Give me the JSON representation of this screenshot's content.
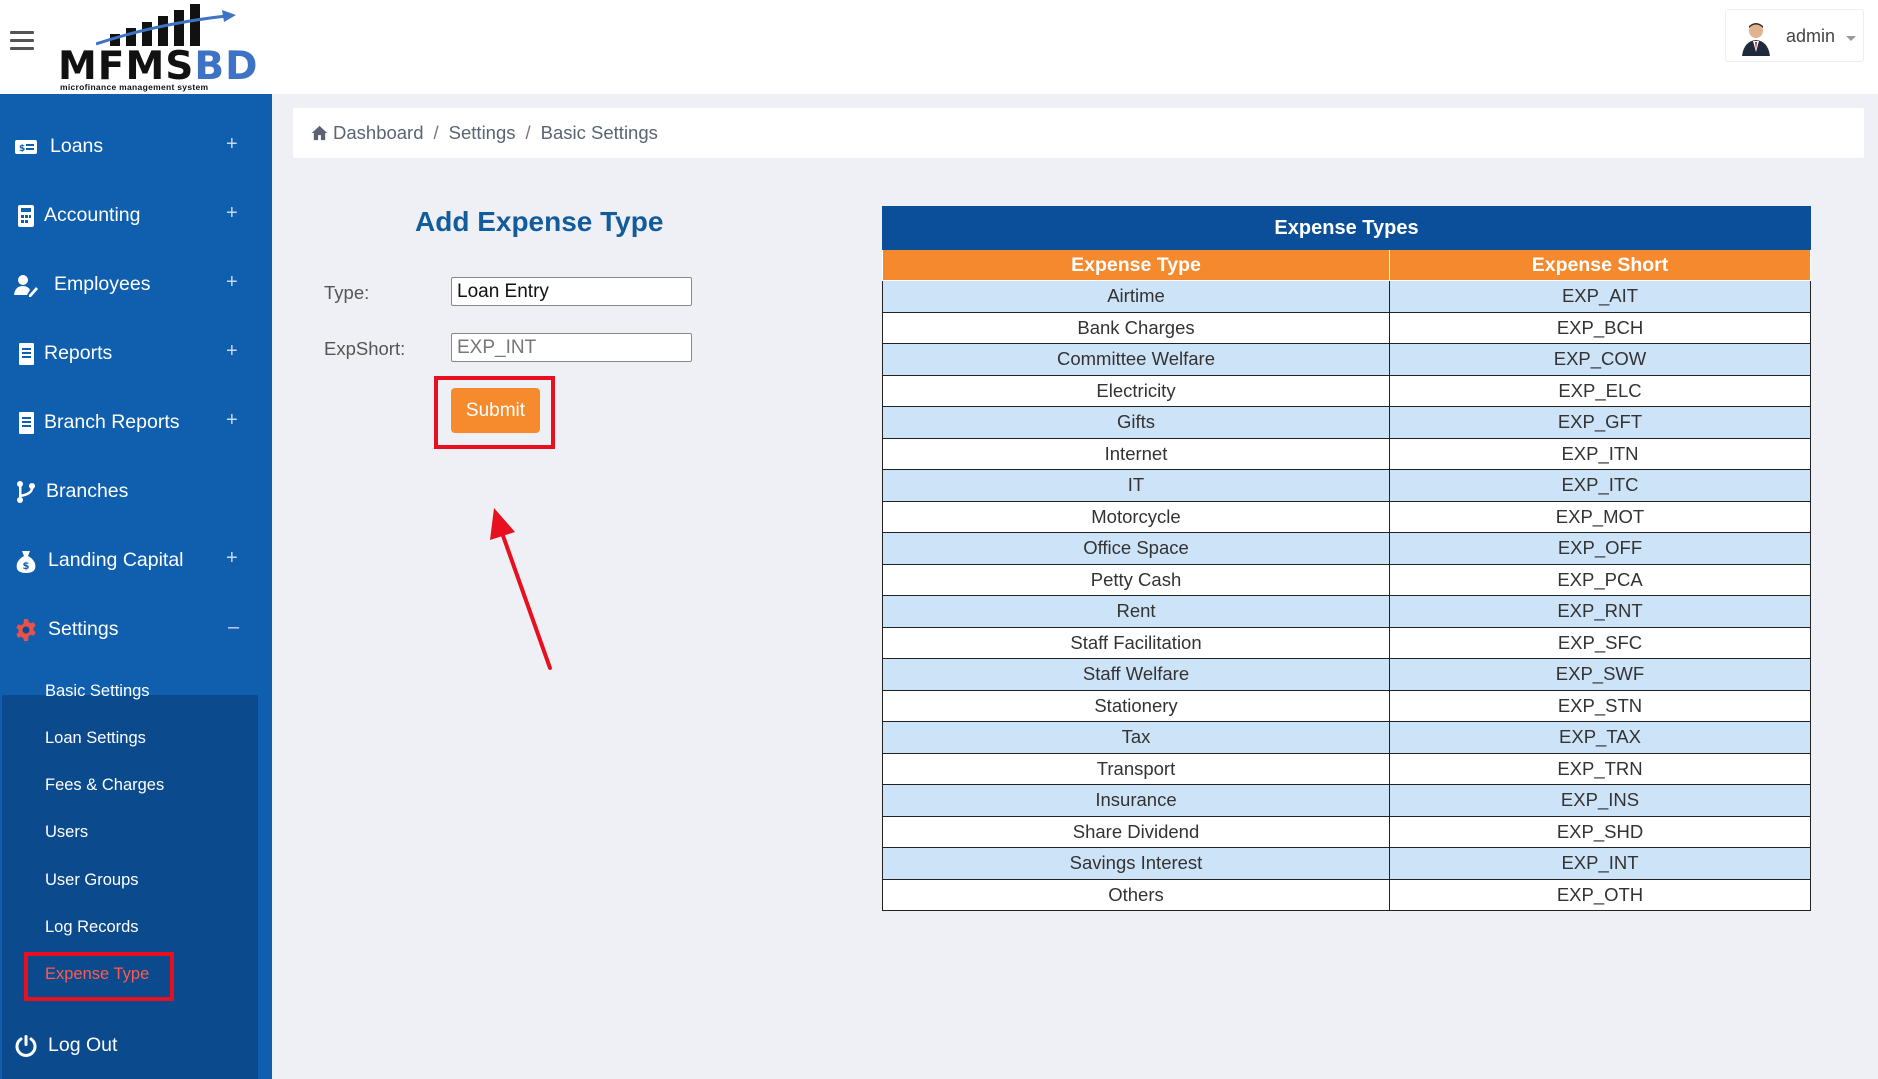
{
  "header": {
    "logo_word": "MFMS",
    "logo_word_accent": "BD",
    "logo_tagline": "microfinance management system",
    "user_name": "admin"
  },
  "sidebar": {
    "items": [
      {
        "label": "Loans",
        "icon": "money-card-icon",
        "expand": "+"
      },
      {
        "label": "Accounting",
        "icon": "calculator-icon",
        "expand": "+"
      },
      {
        "label": "Employees",
        "icon": "user-edit-icon",
        "expand": "+"
      },
      {
        "label": "Reports",
        "icon": "document-icon",
        "expand": "+"
      },
      {
        "label": "Branch Reports",
        "icon": "document-icon",
        "expand": "+"
      },
      {
        "label": "Branches",
        "icon": "branch-icon",
        "expand": ""
      },
      {
        "label": "Landing Capital",
        "icon": "money-bag-icon",
        "expand": "+"
      },
      {
        "label": "Settings",
        "icon": "gear-icon",
        "expand": "–"
      }
    ],
    "settings_submenu": [
      "Basic Settings",
      "Loan Settings",
      "Fees & Charges",
      "Users",
      "User Groups",
      "Log Records",
      "Expense Type"
    ],
    "active_submenu": "Expense Type",
    "logout_label": "Log Out"
  },
  "breadcrumb": {
    "items": [
      "Dashboard",
      "Settings",
      "Basic Settings"
    ],
    "separator": "/"
  },
  "form": {
    "title": "Add Expense Type",
    "type_label": "Type:",
    "type_value": "Loan Entry",
    "expshort_label": "ExpShort:",
    "expshort_placeholder": "EXP_INT",
    "submit_label": "Submit"
  },
  "table": {
    "title": "Expense Types",
    "columns": [
      "Expense Type",
      "Expense Short"
    ],
    "rows": [
      [
        "Airtime",
        "EXP_AIT"
      ],
      [
        "Bank Charges",
        "EXP_BCH"
      ],
      [
        "Committee Welfare",
        "EXP_COW"
      ],
      [
        "Electricity",
        "EXP_ELC"
      ],
      [
        "Gifts",
        "EXP_GFT"
      ],
      [
        "Internet",
        "EXP_ITN"
      ],
      [
        "IT",
        "EXP_ITC"
      ],
      [
        "Motorcycle",
        "EXP_MOT"
      ],
      [
        "Office Space",
        "EXP_OFF"
      ],
      [
        "Petty Cash",
        "EXP_PCA"
      ],
      [
        "Rent",
        "EXP_RNT"
      ],
      [
        "Staff Facilitation",
        "EXP_SFC"
      ],
      [
        "Staff Welfare",
        "EXP_SWF"
      ],
      [
        "Stationery",
        "EXP_STN"
      ],
      [
        "Tax",
        "EXP_TAX"
      ],
      [
        "Transport",
        "EXP_TRN"
      ],
      [
        "Insurance",
        "EXP_INS"
      ],
      [
        "Share Dividend",
        "EXP_SHD"
      ],
      [
        "Savings Interest",
        "EXP_INT"
      ],
      [
        "Others",
        "EXP_OTH"
      ]
    ]
  },
  "colors": {
    "sidebar": "#0f5fae",
    "sidebar_submenu_bg": "#0a4a8d",
    "accent_orange": "#f68b2e",
    "table_header": "#0b4f9a",
    "row_alt": "#cde3f7",
    "highlight": "#e8101e",
    "active_link": "#ff5a4f"
  }
}
